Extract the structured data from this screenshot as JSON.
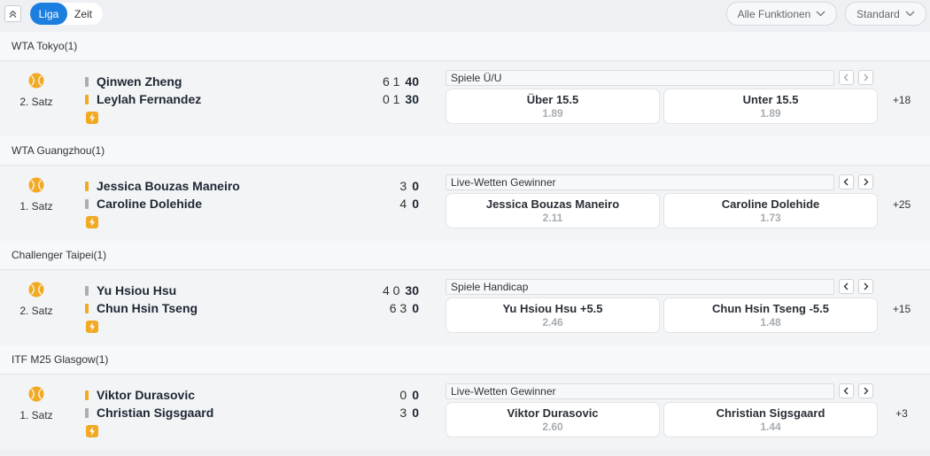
{
  "topbar": {
    "tabs": [
      {
        "label": "Liga",
        "active": true
      },
      {
        "label": "Zeit",
        "active": false
      }
    ],
    "filter_dropdown": "Alle Funktionen",
    "view_dropdown": "Standard"
  },
  "colors": {
    "accent": "#1c7fe0",
    "serve": "#f2a923",
    "ball": "#f2a923"
  },
  "leagues": [
    {
      "name": "WTA Tokyo(1)",
      "match": {
        "set": "2. Satz",
        "players": [
          {
            "name": "Qinwen Zheng",
            "serving": false,
            "sets": "6 1",
            "points": "40"
          },
          {
            "name": "Leylah Fernandez",
            "serving": true,
            "sets": "0 1",
            "points": "30"
          }
        ],
        "market": "Spiele Ü/U",
        "odds": [
          {
            "label": "Über 15.5",
            "value": "1.89"
          },
          {
            "label": "Unter 15.5",
            "value": "1.89"
          }
        ],
        "more": "+18"
      }
    },
    {
      "name": "WTA Guangzhou(1)",
      "match": {
        "set": "1. Satz",
        "players": [
          {
            "name": "Jessica Bouzas Maneiro",
            "serving": true,
            "sets": "3",
            "points": "0"
          },
          {
            "name": "Caroline Dolehide",
            "serving": false,
            "sets": "4",
            "points": "0"
          }
        ],
        "market": "Live-Wetten Gewinner",
        "odds": [
          {
            "label": "Jessica Bouzas Maneiro",
            "value": "2.11"
          },
          {
            "label": "Caroline Dolehide",
            "value": "1.73"
          }
        ],
        "more": "+25"
      }
    },
    {
      "name": "Challenger Taipei(1)",
      "match": {
        "set": "2. Satz",
        "players": [
          {
            "name": "Yu Hsiou Hsu",
            "serving": false,
            "sets": "4 0",
            "points": "30"
          },
          {
            "name": "Chun Hsin Tseng",
            "serving": true,
            "sets": "6 3",
            "points": "0"
          }
        ],
        "market": "Spiele Handicap",
        "odds": [
          {
            "label": "Yu Hsiou Hsu  +5.5",
            "value": "2.46"
          },
          {
            "label": "Chun Hsin Tseng  -5.5",
            "value": "1.48"
          }
        ],
        "more": "+15"
      }
    },
    {
      "name": "ITF M25 Glasgow(1)",
      "match": {
        "set": "1. Satz",
        "players": [
          {
            "name": "Viktor Durasovic",
            "serving": true,
            "sets": "0",
            "points": "0"
          },
          {
            "name": "Christian Sigsgaard",
            "serving": false,
            "sets": "3",
            "points": "0"
          }
        ],
        "market": "Live-Wetten Gewinner",
        "odds": [
          {
            "label": "Viktor Durasovic",
            "value": "2.60"
          },
          {
            "label": "Christian Sigsgaard",
            "value": "1.44"
          }
        ],
        "more": "+3"
      }
    }
  ]
}
